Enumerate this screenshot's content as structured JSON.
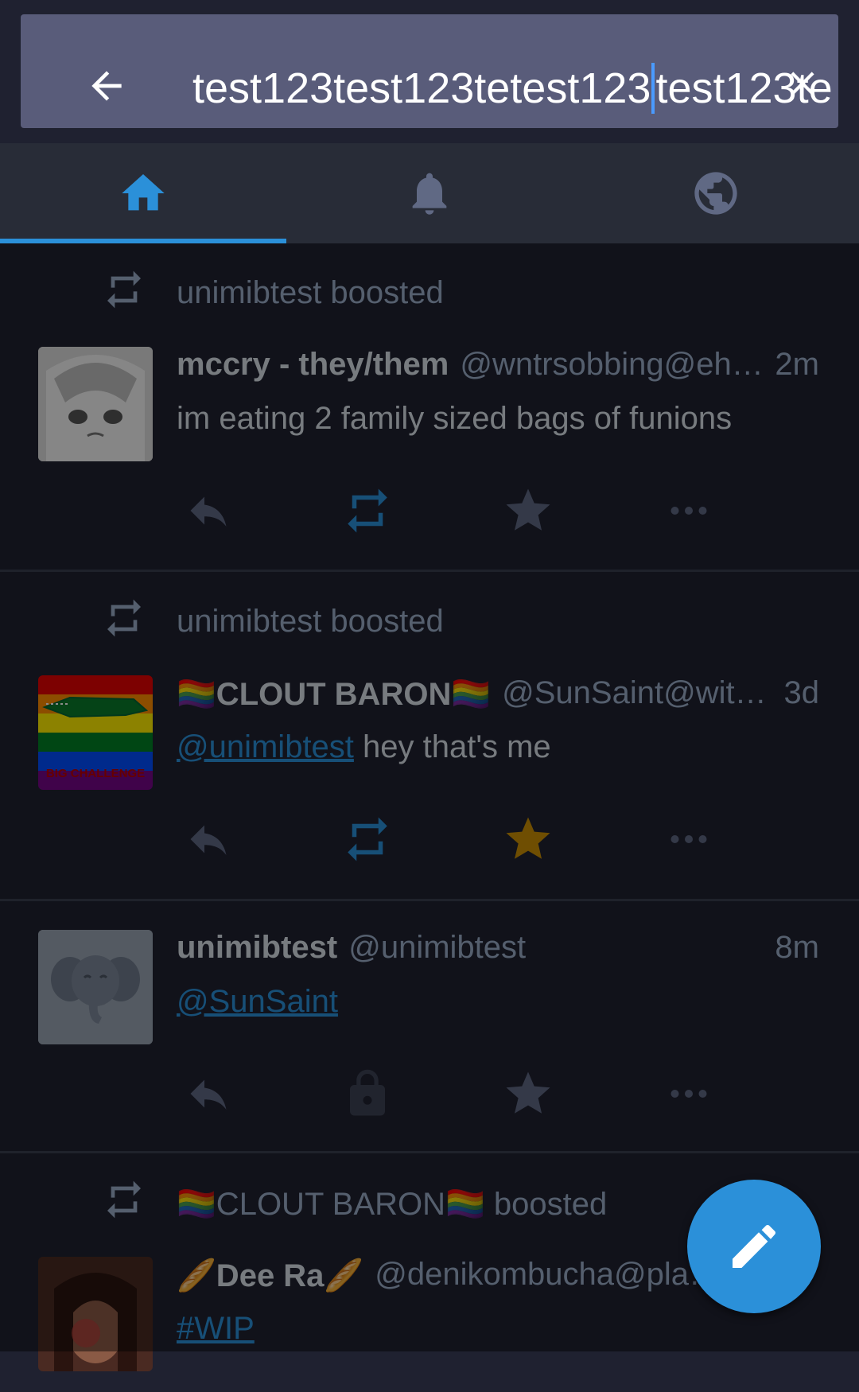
{
  "search": {
    "query_before_caret": "test123test123tetest123",
    "query_after_caret": "test123te"
  },
  "tabs": [
    {
      "name": "home",
      "icon": "home-icon",
      "active": true
    },
    {
      "name": "notifications",
      "icon": "bell-icon",
      "active": false
    },
    {
      "name": "public",
      "icon": "globe-icon",
      "active": false
    }
  ],
  "colors": {
    "accent": "#2b90d9",
    "favourite": "#ca8f04",
    "background": "#282c37"
  },
  "statuses": [
    {
      "boosted_by": "unimibtest boosted",
      "display_name": "mccry - they/them",
      "handle": "@wntrsobbing@eh…",
      "time": "2m",
      "content": "im eating 2 family sized bags of funions"
    },
    {
      "boosted_by": "unimibtest boosted",
      "display_name": "🏳️‍🌈CLOUT BARON🏳️‍🌈",
      "handle": "@SunSaint@wit…",
      "time": "3d",
      "content_mention": "@unimibtest",
      "content_text": " hey that's me",
      "avatar_caption": "BIG CHALLENGE"
    },
    {
      "display_name": "unimibtest",
      "handle": "@unimibtest",
      "time": "8m",
      "content_mention": "@SunSaint"
    },
    {
      "boosted_by_name": "🏳️‍🌈CLOUT BARON🏳️‍🌈",
      "boosted_by_suffix": " boosted",
      "display_name": "🥖Dee Ra🥖",
      "handle": "@denikombucha@pla…",
      "content_hashtag": "#WIP"
    }
  ]
}
